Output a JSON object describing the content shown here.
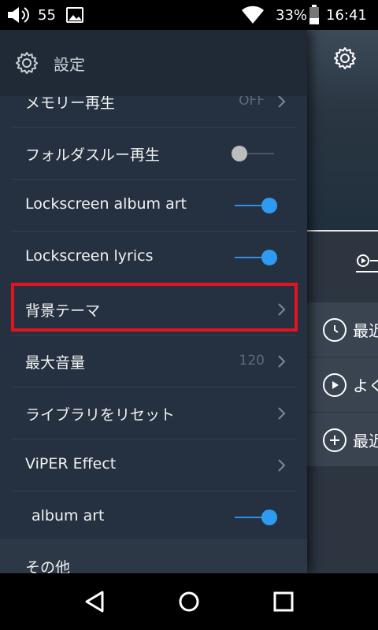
{
  "status_bar": {
    "volume_icon": "volume-icon",
    "volume_level": "55",
    "image_icon": "image-icon",
    "wifi_icon": "wifi-icon",
    "battery_percent": "33%",
    "battery_icon": "battery-icon",
    "time": "16:41"
  },
  "drawer": {
    "header": {
      "icon": "gear-icon",
      "title": "設定"
    },
    "items": [
      {
        "label": "メモリー再生",
        "value": "OFF",
        "control": "chevron"
      },
      {
        "label": "フォルダスルー再生",
        "control": "toggle",
        "state": "off"
      },
      {
        "label": "Lockscreen album art",
        "control": "toggle",
        "state": "on"
      },
      {
        "label": "Lockscreen lyrics",
        "control": "toggle",
        "state": "on"
      },
      {
        "label": "背景テーマ",
        "control": "chevron",
        "highlighted": true
      },
      {
        "label": "最大音量",
        "value": "120",
        "control": "chevron"
      },
      {
        "label": "ライブラリをリセット",
        "control": "chevron"
      },
      {
        "label": "ViPER Effect",
        "control": "chevron"
      },
      {
        "label": "album art",
        "control": "toggle",
        "state": "on"
      }
    ],
    "section": {
      "label": "その他"
    }
  },
  "behind_panel": {
    "gear_icon": "gear-icon",
    "tab_icon": "play-circle-icon",
    "rows": [
      {
        "icon": "clock-icon",
        "text": "最近"
      },
      {
        "icon": "play-icon",
        "text": "よく"
      },
      {
        "icon": "plus-icon",
        "text": "最近"
      }
    ]
  },
  "navbar": {
    "back_icon": "back-icon",
    "home_icon": "home-icon",
    "recent_icon": "recent-apps-icon"
  },
  "colors": {
    "drawer_bg": "#253140",
    "accent": "#2f9bf0",
    "highlight": "#e4141f"
  }
}
